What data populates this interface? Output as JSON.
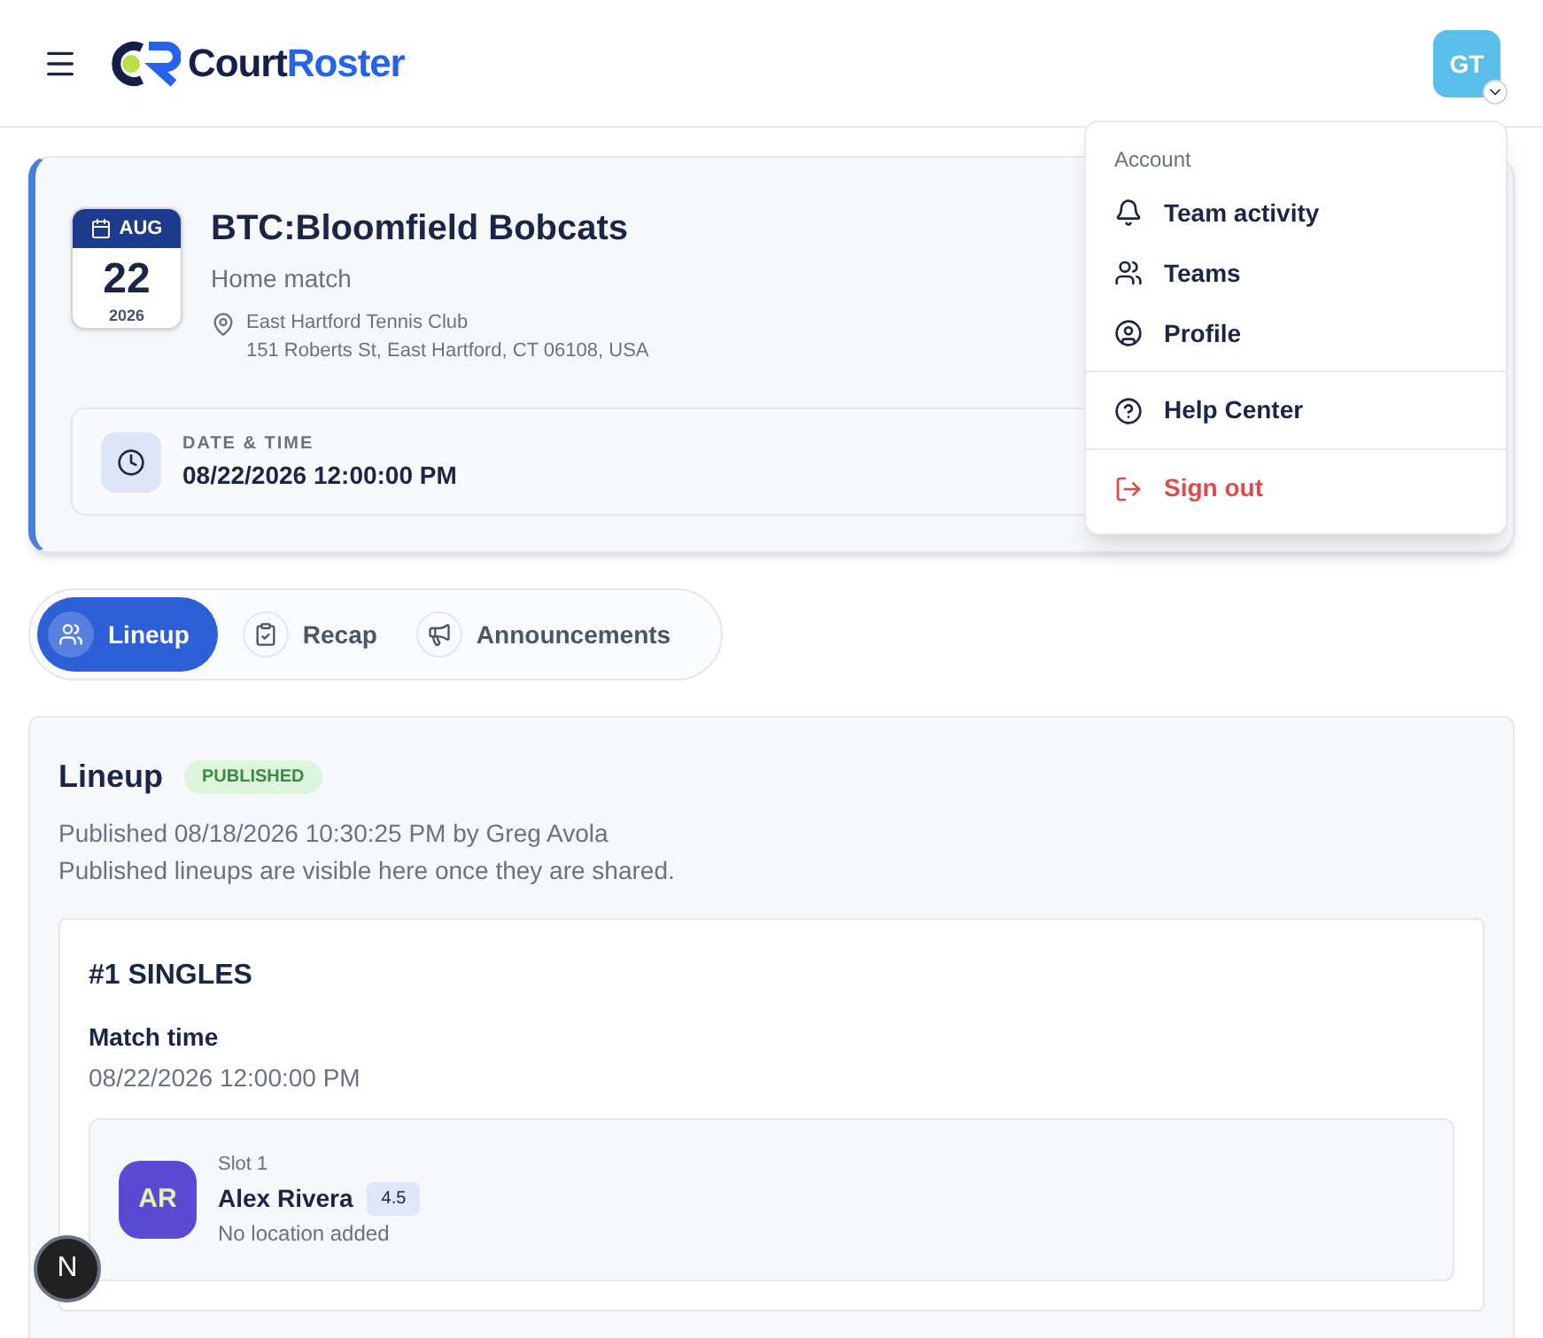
{
  "header": {
    "brand_dark": "Court",
    "brand_accent": "Roster",
    "avatar": "GT"
  },
  "account_menu": {
    "heading": "Account",
    "items": [
      {
        "kind": "bell",
        "label": "Team activity",
        "danger": false,
        "divider_before": false
      },
      {
        "kind": "people",
        "label": "Teams",
        "danger": false,
        "divider_before": false
      },
      {
        "kind": "user",
        "label": "Profile",
        "danger": false,
        "divider_before": false
      },
      {
        "kind": "help",
        "label": "Help Center",
        "danger": false,
        "divider_before": true
      },
      {
        "kind": "logout",
        "label": "Sign out",
        "danger": true,
        "divider_before": true
      }
    ]
  },
  "match": {
    "month": "AUG",
    "day": "22",
    "year": "2026",
    "title": "BTC:Bloomfield Bobcats",
    "subtitle": "Home match",
    "venue": "East Hartford Tennis Club",
    "address": "151 Roberts St, East Hartford, CT 06108, USA",
    "datetime_label": "DATE & TIME",
    "datetime": "08/22/2026 12:00:00 PM"
  },
  "tabs": [
    {
      "kind": "people",
      "label": "Lineup",
      "selected": true
    },
    {
      "kind": "clipboard",
      "label": "Recap",
      "selected": false
    },
    {
      "kind": "megaphone",
      "label": "Announcements",
      "selected": false
    }
  ],
  "lineup": {
    "title": "Lineup",
    "status": "PUBLISHED",
    "published_line": "Published 08/18/2026 10:30:25 PM by Greg Avola",
    "note": "Published lineups are visible here once they are shared.",
    "positions": [
      {
        "title": "#1 SINGLES",
        "time_label": "Match time",
        "time": "08/22/2026 12:00:00 PM",
        "players": [
          {
            "slot": "Slot 1",
            "initials": "AR",
            "name": "Alex Rivera",
            "rating": "4.5",
            "location": "No location added"
          }
        ]
      }
    ]
  },
  "dev_badge": "N"
}
